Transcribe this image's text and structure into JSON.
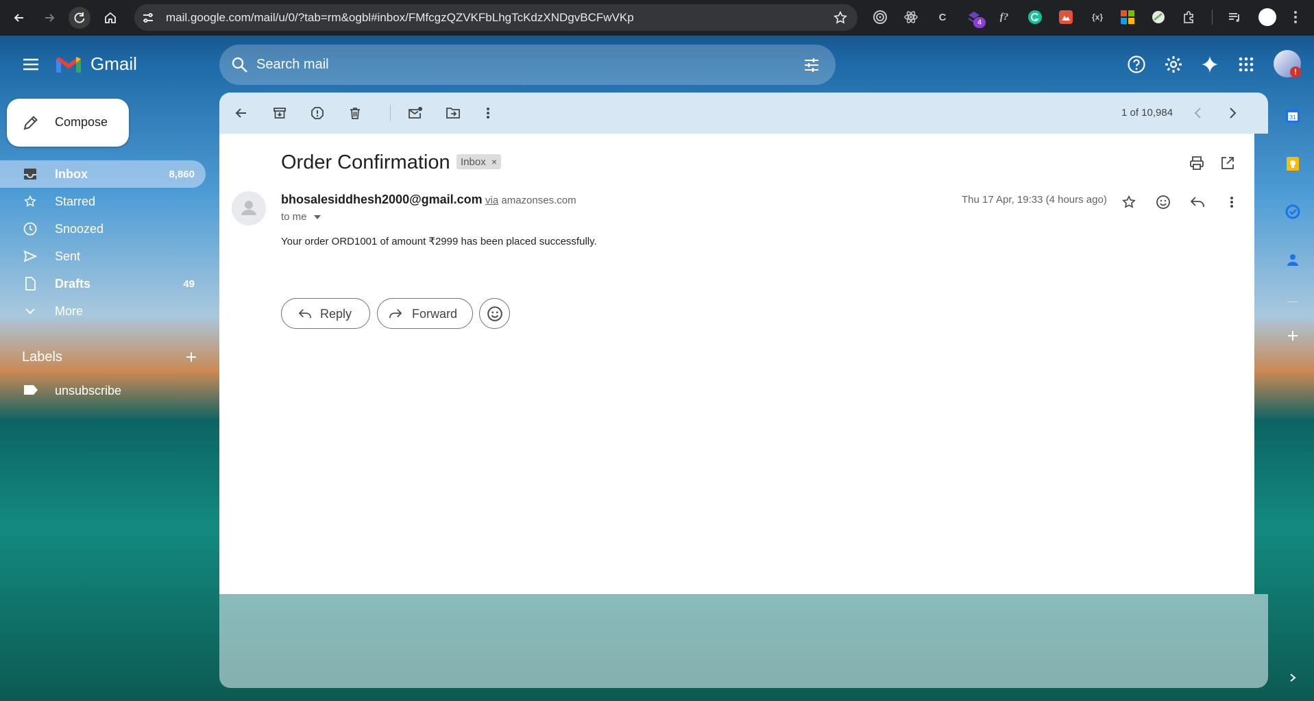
{
  "browser": {
    "url": "mail.google.com/mail/u/0/?tab=rm&ogbl#inbox/FMfcgzQZVKFbLhgTcKdzXNDgvBCFwVKp",
    "extension_badge": "4"
  },
  "header": {
    "logo_text": "Gmail",
    "search_placeholder": "Search mail"
  },
  "sidebar": {
    "compose_label": "Compose",
    "items": [
      {
        "label": "Inbox",
        "count": "8,860",
        "icon": "inbox-icon"
      },
      {
        "label": "Starred",
        "count": "",
        "icon": "star-icon"
      },
      {
        "label": "Snoozed",
        "count": "",
        "icon": "clock-icon"
      },
      {
        "label": "Sent",
        "count": "",
        "icon": "send-icon"
      },
      {
        "label": "Drafts",
        "count": "49",
        "icon": "draft-icon"
      },
      {
        "label": "More",
        "count": "",
        "icon": "chevron-down-icon"
      }
    ],
    "labels_title": "Labels",
    "labels": [
      {
        "label": "unsubscribe",
        "icon": "label-icon"
      }
    ]
  },
  "toolbar": {
    "pager": "1 of 10,984"
  },
  "message": {
    "subject": "Order Confirmation",
    "chip": "Inbox",
    "sender": "bhosalesiddhesh2000@gmail.com",
    "via_word": "via",
    "via_domain": "amazonses.com",
    "to": "to me",
    "date": "Thu 17 Apr, 19:33 (4 hours ago)",
    "body": "Your order ORD1001 of amount ₹2999 has been placed successfully."
  },
  "actions": {
    "reply_label": "Reply",
    "forward_label": "Forward"
  },
  "colors": {
    "chrome_bg": "#202124",
    "toolbar_bg": "#d8e7f4",
    "gmail_red": "#ea4335"
  }
}
